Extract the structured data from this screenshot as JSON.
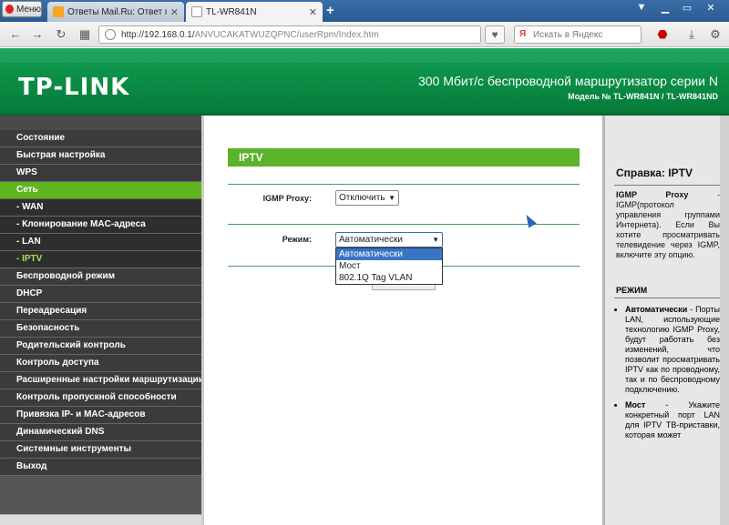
{
  "browser": {
    "menu_label": "Меню",
    "tabs": [
      {
        "label": "Ответы Mail.Ru: Ответ пол"
      },
      {
        "label": "TL-WR841N"
      }
    ],
    "url_host": "http://192.168.0.1/",
    "url_path": "ANVUCAKATWUZQPNC/userRpm/Index.htm",
    "search_placeholder": "Искать в Яндекс"
  },
  "header": {
    "logo": "TP-LINK",
    "title": "300 Мбит/с беспроводной маршрутизатор серии N",
    "model": "Модель № TL-WR841N / TL-WR841ND"
  },
  "sidebar": {
    "items": [
      {
        "label": "Состояние"
      },
      {
        "label": "Быстрая настройка"
      },
      {
        "label": "WPS"
      },
      {
        "label": "Сеть"
      },
      {
        "label": "- WAN"
      },
      {
        "label": "- Клонирование MAC-адреса"
      },
      {
        "label": "- LAN"
      },
      {
        "label": "- IPTV"
      },
      {
        "label": "Беспроводной режим"
      },
      {
        "label": "DHCP"
      },
      {
        "label": "Переадресация"
      },
      {
        "label": "Безопасность"
      },
      {
        "label": "Родительский контроль"
      },
      {
        "label": "Контроль доступа"
      },
      {
        "label": "Расширенные настройки маршрутизации"
      },
      {
        "label": "Контроль пропускной способности"
      },
      {
        "label": "Привязка IP- и MAC-адресов"
      },
      {
        "label": "Динамический DNS"
      },
      {
        "label": "Системные инструменты"
      },
      {
        "label": "Выход"
      }
    ]
  },
  "main": {
    "section_title": "IPTV",
    "igmp_label": "IGMP Proxy:",
    "igmp_value": "Отключить",
    "mode_label": "Режим:",
    "mode_value": "Автоматически",
    "mode_options": [
      "Автоматически",
      "Мост",
      "802.1Q Tag VLAN"
    ]
  },
  "help": {
    "title": "Справка: IPTV",
    "intro_term": "IGMP Proxy",
    "intro_text": " - IGMP(протокол управления группами Интернета). Если Вы хотите просматривать телевидение через IGMP, включите эту опцию.",
    "mode_heading": "РЕЖИМ",
    "item1_term": "Автоматически",
    "item1_text": " - Порты LAN, использующие технологию IGMP Proxy, будут работать без изменений, что позволит просматривать IPTV как по проводному, так и по беспроводному подключению.",
    "item2_term": "Мост",
    "item2_text": " - Укажите конкретный порт LAN для IPTV ТВ-приставки, которая может"
  }
}
